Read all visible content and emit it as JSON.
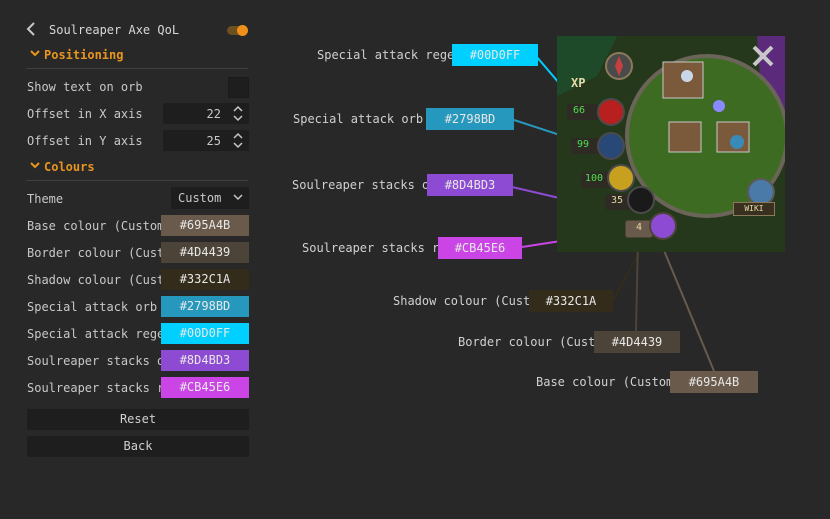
{
  "header": {
    "title": "Soulreaper Axe QoL",
    "back_icon": "chevron-left-icon",
    "toggle_on": true,
    "accent": "#f0901a"
  },
  "positioning": {
    "title": "Positioning",
    "show_text_label": "Show text on orb",
    "offset_x_label": "Offset in X axis",
    "offset_x_value": "22",
    "offset_y_label": "Offset in Y axis",
    "offset_y_value": "25"
  },
  "colours": {
    "title": "Colours",
    "theme_label": "Theme",
    "theme_value": "Custom",
    "items": [
      {
        "label": "Base colour (Custom)",
        "hex": "#695A4B",
        "color": "#695A4B"
      },
      {
        "label": "Border colour (Custom)",
        "hex": "#4D4439",
        "color": "#4D4439"
      },
      {
        "label": "Shadow colour (Custom)",
        "hex": "#332C1A",
        "color": "#332C1A"
      },
      {
        "label": "Special attack orb col...",
        "hex": "#2798BD",
        "color": "#2798BD"
      },
      {
        "label": "Special attack regen c...",
        "hex": "#00D0FF",
        "color": "#00D0FF"
      },
      {
        "label": "Soulreaper stacks orb...",
        "hex": "#8D4BD3",
        "color": "#8D4BD3"
      },
      {
        "label": "Soulreaper stacks reg...",
        "hex": "#CB45E6",
        "color": "#CB45E6"
      }
    ]
  },
  "buttons": {
    "reset": "Reset",
    "back": "Back"
  },
  "callouts": [
    {
      "label": "Special attack regen c...",
      "hex": "#00D0FF",
      "color": "#00D0FF"
    },
    {
      "label": "Special attack orb col...",
      "hex": "#2798BD",
      "color": "#2798BD"
    },
    {
      "label": "Soulreaper stacks orb...",
      "hex": "#8D4BD3",
      "color": "#8D4BD3"
    },
    {
      "label": "Soulreaper stacks reg...",
      "hex": "#CB45E6",
      "color": "#CB45E6"
    },
    {
      "label": "Shadow colour (Custom)",
      "hex": "#332C1A",
      "color": "#332C1A"
    },
    {
      "label": "Border colour (Custom)",
      "hex": "#4D4439",
      "color": "#4D4439"
    },
    {
      "label": "Base colour (Custom)",
      "hex": "#695A4B",
      "color": "#695A4B"
    }
  ],
  "minimap": {
    "xp_label": "XP",
    "hp_value": "66",
    "prayer_value": "99",
    "run_value": "100",
    "spec_value": "35",
    "soul_value": "4",
    "wiki_label": "WIKI"
  }
}
